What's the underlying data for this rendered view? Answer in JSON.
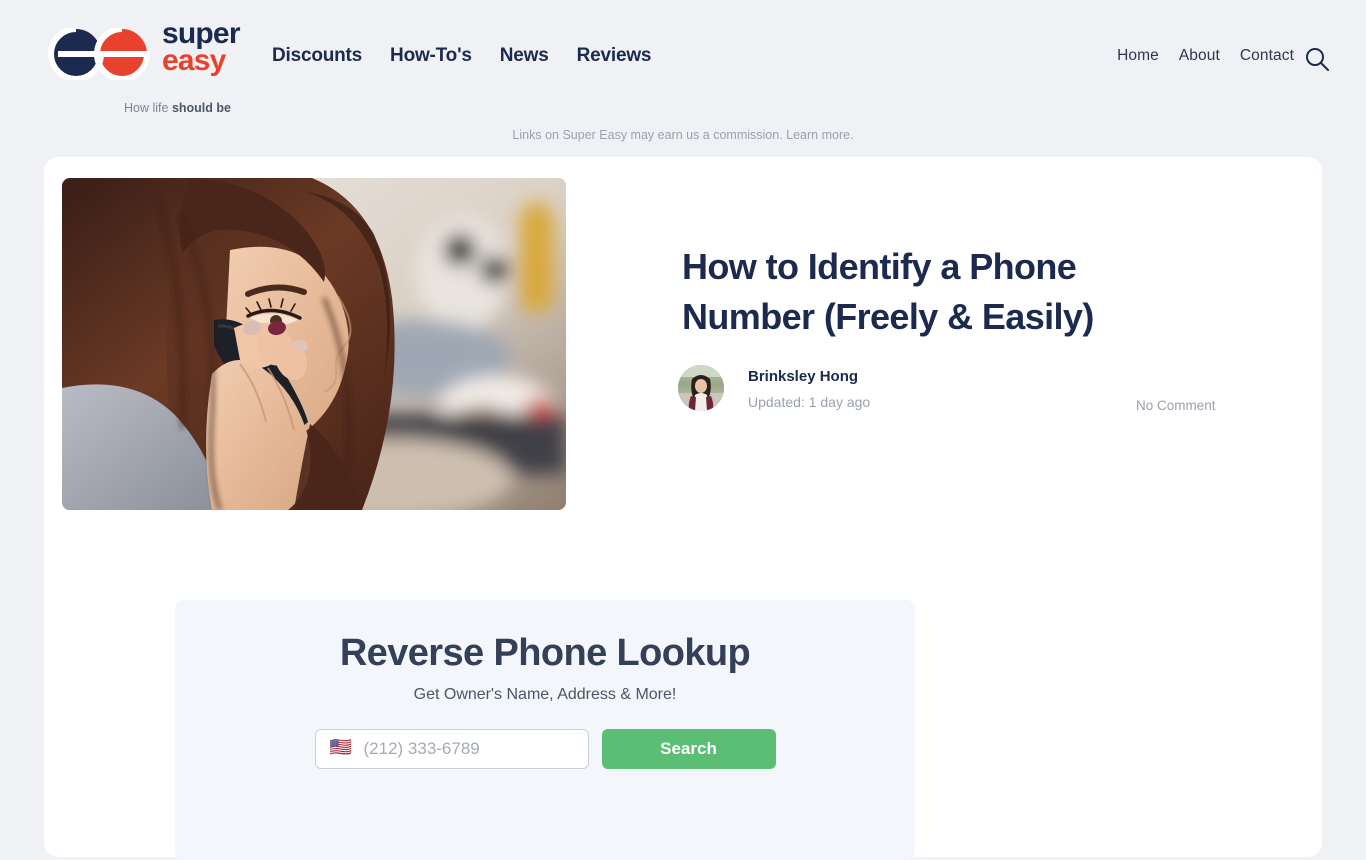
{
  "brand": {
    "name_line1": "super",
    "name_line2": "easy",
    "tagline_prefix": "How life ",
    "tagline_strong": "should be",
    "color_navy": "#1b2a4e",
    "color_red": "#e8422e"
  },
  "header": {
    "main_nav": [
      {
        "label": "Discounts"
      },
      {
        "label": "How-To's"
      },
      {
        "label": "News"
      },
      {
        "label": "Reviews"
      }
    ],
    "sub_nav": [
      {
        "label": "Home"
      },
      {
        "label": "About"
      },
      {
        "label": "Contact"
      }
    ],
    "search_icon": "search-icon"
  },
  "disclaimer": "Links on Super Easy may earn us a commission. Learn more.",
  "article": {
    "title": "How to Identify a Phone Number (Freely & Easily)",
    "hero_alt": "Woman with long auburn hair talking on a mobile phone",
    "author": "Brinksley Hong",
    "updated": "Updated: 1 day ago",
    "comments": "No Comment"
  },
  "lookup": {
    "title": "Reverse Phone Lookup",
    "subtitle": "Get Owner's Name, Address & More!",
    "country_flag": "🇺🇸",
    "phone_placeholder": "(212) 333-6789",
    "phone_value": "",
    "search_label": "Search",
    "button_color": "#5cbd75",
    "panel_color": "#f3f6fa"
  }
}
